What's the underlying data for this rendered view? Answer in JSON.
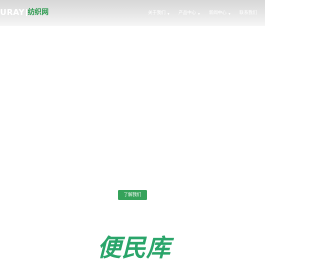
{
  "header": {
    "logo": {
      "latin": "URAY",
      "chinese": "纺织网"
    },
    "nav": [
      {
        "label": "关于我们",
        "icon": "chevron-down-icon"
      },
      {
        "label": "产品中心",
        "icon": "chevron-down-icon"
      },
      {
        "label": "新闻中心",
        "icon": "chevron-down-icon"
      },
      {
        "label": "联系我们",
        "icon": ""
      }
    ]
  },
  "hero": {
    "cta_label": "了解我们"
  },
  "watermark": {
    "text": "便民库"
  },
  "colors": {
    "brand_green": "#2c9a4f",
    "cta_green": "#35a25a",
    "watermark_green": "#2aa56a",
    "header_gray": "#dedede"
  }
}
